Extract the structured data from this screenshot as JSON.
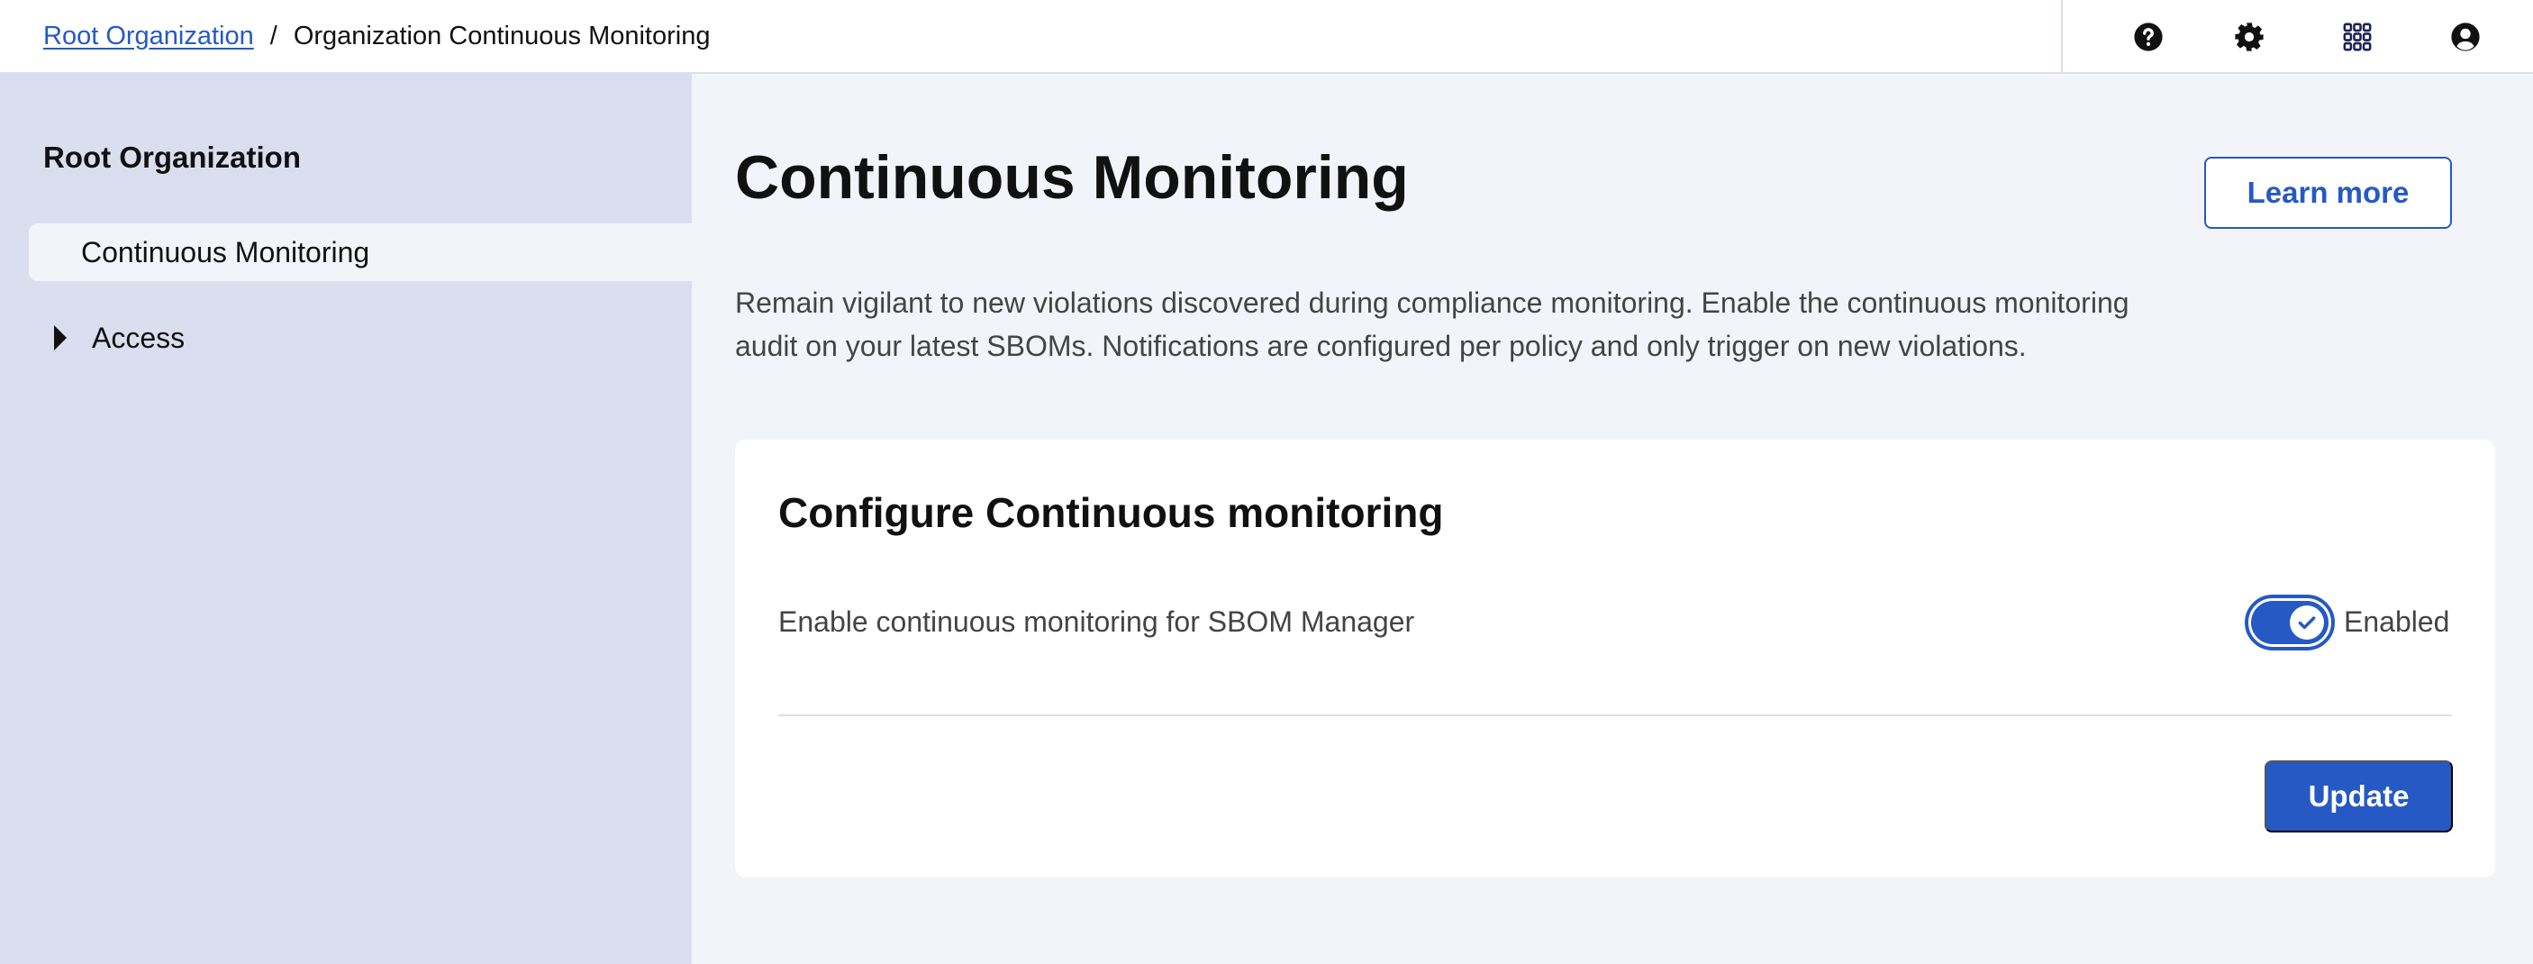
{
  "breadcrumb": {
    "root_label": "Root Organization",
    "separator": "/",
    "current_label": "Organization Continuous Monitoring"
  },
  "header_icons": [
    "help-icon",
    "gear-icon",
    "apps-grid-icon",
    "user-account-icon"
  ],
  "sidebar": {
    "title": "Root Organization",
    "items": [
      {
        "label": "Continuous Monitoring",
        "active": true
      },
      {
        "label": "Access",
        "expandable": true,
        "expanded": false
      }
    ]
  },
  "main": {
    "title": "Continuous Monitoring",
    "learn_more_label": "Learn more",
    "description": "Remain vigilant to new violations discovered during compliance monitoring. Enable the continuous monitoring audit on your latest SBOMs. Notifications are configured per policy and only trigger on new violations.",
    "card": {
      "title": "Configure Continuous monitoring",
      "setting_label": "Enable continuous monitoring for SBOM Manager",
      "toggle_enabled": true,
      "toggle_state_label": "Enabled",
      "update_label": "Update"
    }
  },
  "colors": {
    "accent": "#2659c3",
    "sidebar_bg": "#dbdeef",
    "page_bg": "#f3f4f9"
  }
}
